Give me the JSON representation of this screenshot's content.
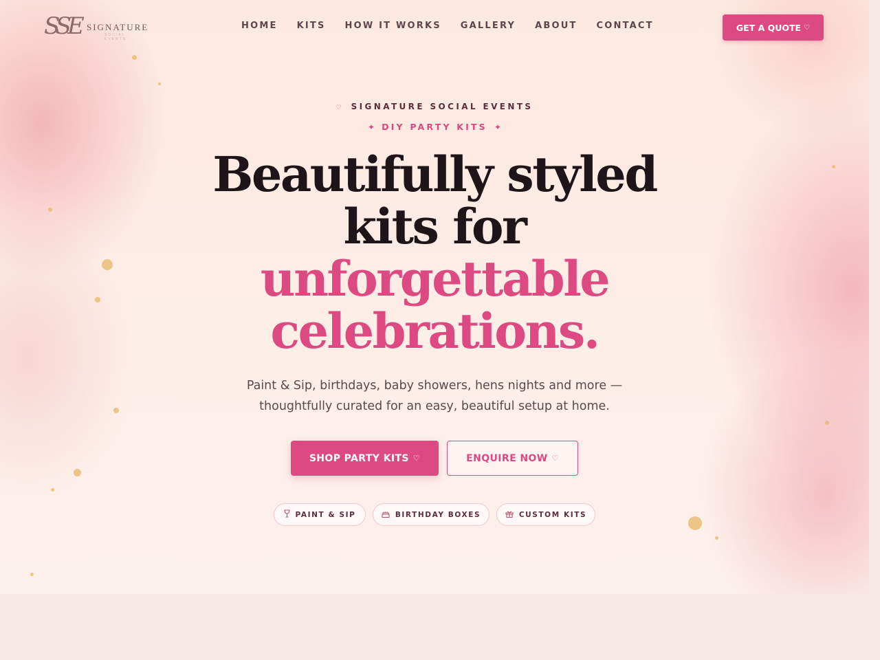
{
  "brand": {
    "monogram": "SSE",
    "wordmark": "SIGNATURE",
    "tagline": "SOCIAL EVENTS"
  },
  "nav": {
    "items": [
      {
        "label": "HOME"
      },
      {
        "label": "KITS"
      },
      {
        "label": "HOW IT WORKS"
      },
      {
        "label": "GALLERY"
      },
      {
        "label": "ABOUT"
      },
      {
        "label": "CONTACT"
      }
    ],
    "cta_label": "GET A QUOTE",
    "cta_icon": "♡"
  },
  "hero": {
    "eyebrow_icon": "♡",
    "eyebrow": "SIGNATURE SOCIAL EVENTS",
    "kicker_star": "✦",
    "kicker": "DIY PARTY KITS",
    "headline_line1": "Beautifully styled",
    "headline_line2": "kits for",
    "headline_line3": "unforgettable",
    "headline_line4": "celebrations.",
    "subtext": "Paint & Sip, birthdays, baby showers, hens nights and more — thoughtfully curated for an easy, beautiful setup at home.",
    "primary_button": "SHOP PARTY KITS",
    "secondary_button": "ENQUIRE NOW",
    "button_icon": "♡",
    "chips": [
      {
        "icon": "wine-glass-icon",
        "glyph": "🍷",
        "label": "PAINT & SIP"
      },
      {
        "icon": "cake-icon",
        "glyph": "🎂",
        "label": "BIRTHDAY BOXES"
      },
      {
        "icon": "gift-icon",
        "glyph": "🎁",
        "label": "CUSTOM KITS"
      }
    ]
  },
  "colors": {
    "accent": "#dc4a81",
    "text_dark": "#1f1518",
    "background": "#fdeee8"
  }
}
